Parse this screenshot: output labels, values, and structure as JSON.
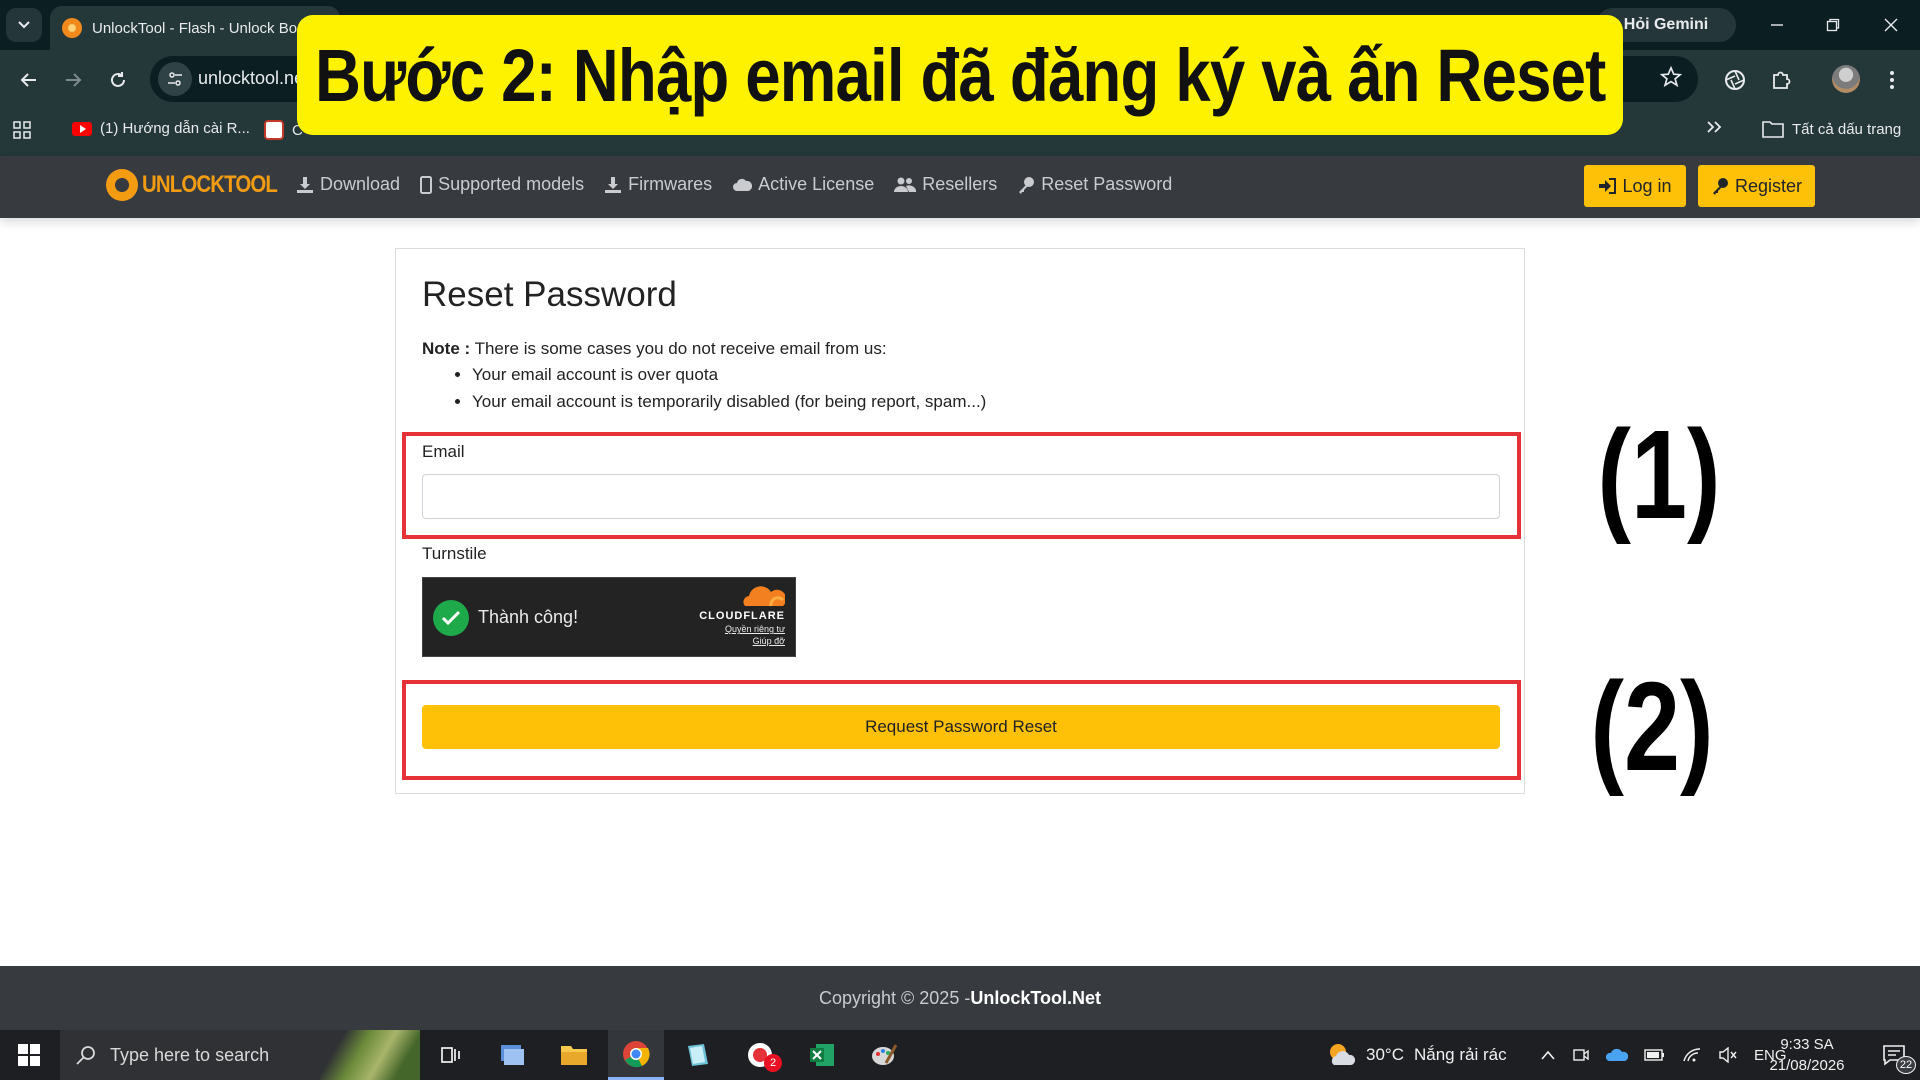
{
  "browser": {
    "tab_title": "UnlockTool - Flash - Unlock Boo",
    "gemini_label": "Hỏi Gemini",
    "url": "unlocktool.ne",
    "bookmarks": [
      {
        "label": "(1) Hướng dẫn cài R...",
        "icon": "youtube-icon"
      },
      {
        "label": "C",
        "icon": "bookmark-icon"
      }
    ],
    "all_bookmarks": "Tất cả dấu trang"
  },
  "banner": {
    "text": "Bước 2: Nhập email đã đăng ký và ấn Reset",
    "color": "#fff200"
  },
  "site_nav": {
    "logo_text": "UNLOCKTOOL",
    "links": [
      {
        "label": "Download",
        "icon": "download-icon"
      },
      {
        "label": "Supported models",
        "icon": "mobile-icon"
      },
      {
        "label": "Firmwares",
        "icon": "download-icon"
      },
      {
        "label": "Active License",
        "icon": "cloud-icon"
      },
      {
        "label": "Resellers",
        "icon": "users-icon"
      },
      {
        "label": "Reset Password",
        "icon": "key-icon"
      }
    ],
    "login_label": "Log in",
    "register_label": "Register",
    "accent_color": "#ffc107"
  },
  "form": {
    "title": "Reset Password",
    "note_prefix": "Note :",
    "note_text": " There is some cases you do not receive email from us:",
    "note_items": [
      "Your email account is over quota",
      "Your email account is temporarily disabled (for being report, spam...)"
    ],
    "email_label": "Email",
    "email_value": "",
    "turnstile_label": "Turnstile",
    "turnstile_status": "Thành công!",
    "cloudflare_word": "CLOUDFLARE",
    "cloudflare_privacy": "Quyền riêng tư",
    "cloudflare_help": "Giúp đỡ",
    "submit_label": "Request Password Reset"
  },
  "annotations": {
    "step1": "(1)",
    "step2": "(2)",
    "box_color": "#e53238"
  },
  "footer": {
    "copyright": "Copyright © 2025 - ",
    "brand": "UnlockTool.Net"
  },
  "taskbar": {
    "search_placeholder": "Type here to search",
    "weather_temp": "30°C",
    "weather_text": "Nắng rải rác",
    "lang": "ENG",
    "time": "9:33 SA",
    "date": "21/08/2026",
    "notification_count": "22",
    "teams_badge": "2"
  }
}
